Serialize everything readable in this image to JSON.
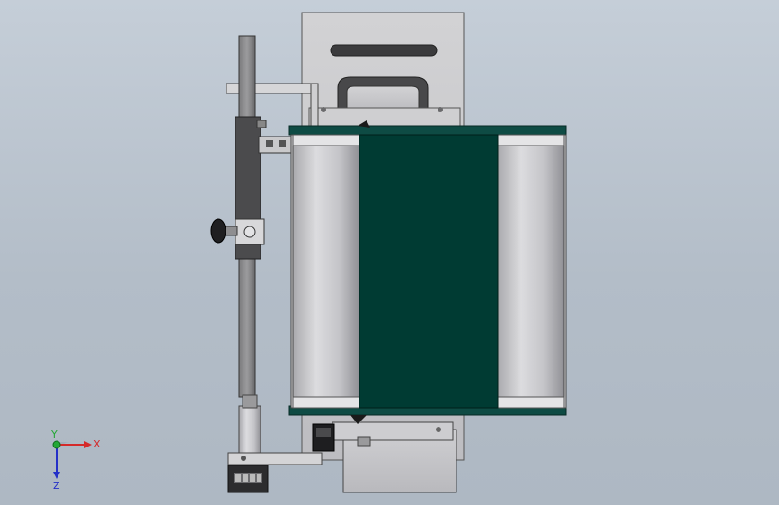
{
  "viewport": {
    "background_top": "#c5ced8",
    "background_bottom": "#aeb8c3"
  },
  "model": {
    "belt_color": "#003b33",
    "roller_color": "#c9c9cd",
    "frame_color": "#5a5a5a",
    "bracket_color": "#d4d4d6"
  },
  "triad": {
    "x_label": "X",
    "y_label": "Y",
    "z_label": "Z",
    "x_color": "#d42a2a",
    "y_color": "#24a835",
    "z_color": "#2430c8"
  }
}
